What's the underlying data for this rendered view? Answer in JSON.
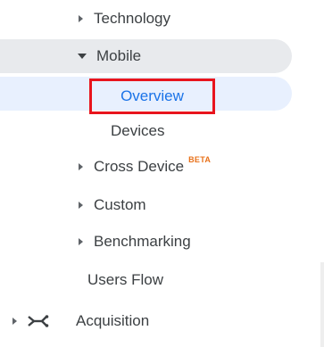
{
  "nav": {
    "technology": {
      "label": "Technology",
      "expanded": false
    },
    "mobile": {
      "label": "Mobile",
      "expanded": true
    },
    "overview": {
      "label": "Overview",
      "selected": true,
      "highlight_color": "#e8141d"
    },
    "devices": {
      "label": "Devices"
    },
    "cross_device": {
      "label": "Cross Device",
      "badge": "BETA",
      "badge_color": "#e8711a"
    },
    "custom": {
      "label": "Custom",
      "expanded": false
    },
    "benchmarking": {
      "label": "Benchmarking",
      "expanded": false
    },
    "users_flow": {
      "label": "Users Flow"
    },
    "acquisition": {
      "label": "Acquisition",
      "icon": "acquisition-fork-icon",
      "expanded": false
    }
  },
  "colors": {
    "selected_bg": "#e8f0fe",
    "selected_text": "#1a73e8",
    "parent_bg": "#e8eaed",
    "text": "#3c4043"
  }
}
